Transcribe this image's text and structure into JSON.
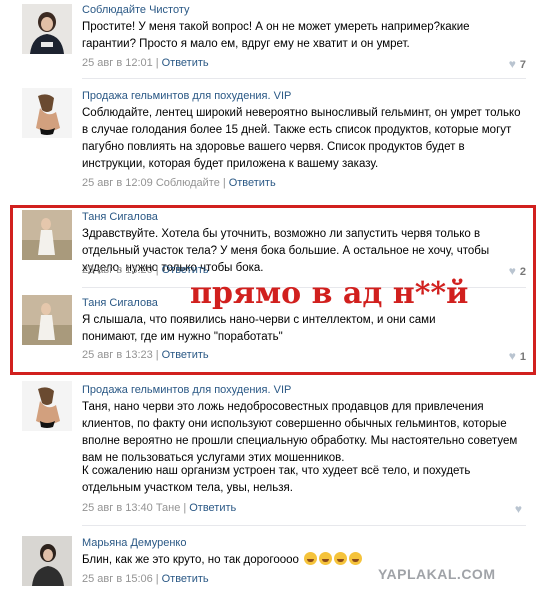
{
  "comments": [
    {
      "author": "Соблюдайте Чистоту",
      "text": "Простите! У меня такой вопрос! А он не может умереть например?какие гарантии? Просто я мало ем, вдруг ему не хватит и он умрет.",
      "date": "25 авг в 12:01",
      "reply_to": "",
      "action": "Ответить",
      "likes": "7"
    },
    {
      "author": "Продажа гельминтов для похудения. VIP",
      "text": "Соблюдайте, лентец широкий невероятно выносливый гельминт, он умрет только в случае голодания более 15 дней. Также есть список продуктов, которые могут пагубно повлиять на здоровье вашего червя. Список продуктов будет в инструкции, которая будет приложена к вашему заказу.",
      "date": "25 авг в 12:09",
      "reply_to": "Соблюдайте",
      "action": "Ответить",
      "likes": ""
    },
    {
      "author": "Таня Сигалова",
      "text": "Здравствуйте. Хотела бы уточнить, возможно ли запустить червя только в отдельный участок тела? У меня бока большие. А остальное не хочу, чтобы худело, нужно только чтобы бока.",
      "date": "25 авг в 13:20",
      "reply_to": "",
      "action": "Ответить",
      "likes": "2"
    },
    {
      "author": "Таня Сигалова",
      "text": "Я слышала, что появились нано-черви с интеллектом, и они сами понимают, где им нужно \"поработать\"",
      "date": "25 авг в 13:23",
      "reply_to": "",
      "action": "Ответить",
      "likes": "1"
    },
    {
      "author": "Продажа гельминтов для похудения. VIP",
      "text": "Таня, нано черви это ложь недобросовестных продавцов для привлечения клиентов, по факту они используют совершенно обычных гельминтов, которые вполне вероятно не прошли специальную обработку. Мы настоятельно советуем вам не пользоваться услугами этих мошенников.",
      "text2": "К сожалению наш организм устроен так, что худеет всё тело, и похудеть отдельным участком тела, увы, нельзя.",
      "date": "25 авг в 13:40",
      "reply_to": "Тане",
      "action": "Ответить",
      "likes": ""
    },
    {
      "author": "Марьяна Демуренко",
      "text": "Блин, как же это круто, но так дорогоооо",
      "date": "25 авг в 15:06",
      "reply_to": "",
      "action": "Ответить",
      "likes": ""
    }
  ],
  "overlay_text": "прямо в ад н**й",
  "watermark": "YAPLAKAL.COM",
  "colors": {
    "link": "#2a5885",
    "meta": "#939393",
    "highlight": "#d1201e"
  }
}
